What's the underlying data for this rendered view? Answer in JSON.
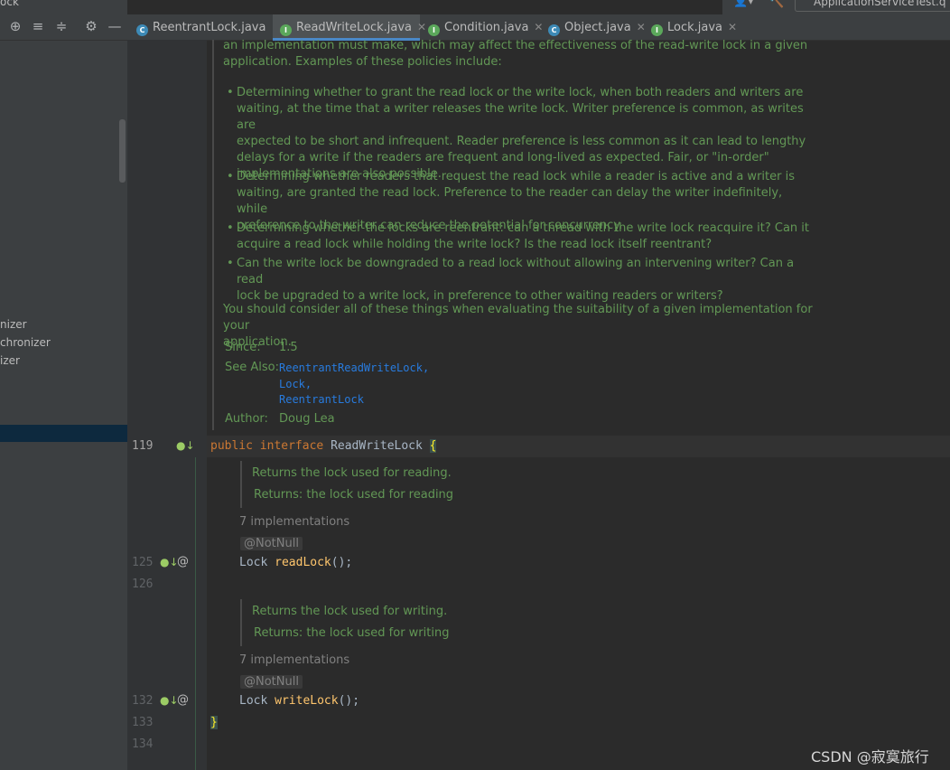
{
  "sidebar": {
    "title_fragment": "ock",
    "items": [
      "nizer",
      "chronizer",
      "izer"
    ]
  },
  "tabs": [
    {
      "label": "ReentrantLock.java",
      "icon": "class-icon",
      "color": "#3d8ab6",
      "active": false
    },
    {
      "label": "ReadWriteLock.java",
      "icon": "interface-icon",
      "color": "#5ba85b",
      "active": true
    },
    {
      "label": "Condition.java",
      "icon": "interface-icon",
      "color": "#5ba85b",
      "active": false
    },
    {
      "label": "Object.java",
      "icon": "class-icon",
      "color": "#3d8ab6",
      "active": false
    },
    {
      "label": "Lock.java",
      "icon": "interface-icon",
      "color": "#5ba85b",
      "active": false
    }
  ],
  "top_right_tab": "ApplicationServiceTest.q",
  "doc": {
    "intro": [
      "an implementation must make, which may affect the effectiveness of the read-write lock in a given",
      "application. Examples of these policies include:"
    ],
    "bullets": [
      [
        "Determining whether to grant the read lock or the write lock, when both readers and writers are",
        "waiting, at the time that a writer releases the write lock. Writer preference is common, as writes are",
        "expected to be short and infrequent. Reader preference is less common as it can lead to lengthy",
        "delays for a write if the readers are frequent and long-lived as expected. Fair, or \"in-order\"",
        "implementations are also possible."
      ],
      [
        "Determining whether readers that request the read lock while a reader is active and a writer is",
        "waiting, are granted the read lock. Preference to the reader can delay the writer indefinitely, while",
        "preference to the writer can reduce the potential for concurrency."
      ],
      [
        "Determining whether the locks are reentrant: can a thread with the write lock reacquire it? Can it",
        "acquire a read lock while holding the write lock? Is the read lock itself reentrant?"
      ],
      [
        "Can the write lock be downgraded to a read lock without allowing an intervening writer? Can a read",
        "lock be upgraded to a write lock, in preference to other waiting readers or writers?"
      ]
    ],
    "closing": [
      "You should consider all of these things when evaluating the suitability of a given implementation for your",
      "application."
    ],
    "since_label": "Since:",
    "since_value": "1.5",
    "see_also_label": "See Also:",
    "see_also": [
      "ReentrantReadWriteLock,",
      "Lock,",
      "ReentrantLock"
    ],
    "author_label": "Author:",
    "author_value": "Doug Lea"
  },
  "code": {
    "line_numbers": [
      "119",
      "125",
      "126",
      "132",
      "133",
      "134"
    ],
    "decl_kw1": "public",
    "decl_kw2": "interface",
    "decl_name": " ReadWriteLock ",
    "decl_brace": "{",
    "read_doc": [
      "Returns the lock used for reading.",
      "Returns: the lock used for reading"
    ],
    "read_impl": "7 implementations",
    "annotation": "@NotNull",
    "read_type": "Lock ",
    "read_fn": "readLock",
    "read_tail": "();",
    "write_doc": [
      "Returns the lock used for writing.",
      "Returns: the lock used for writing"
    ],
    "write_impl": "7 implementations",
    "write_type": "Lock ",
    "write_fn": "writeLock",
    "write_tail": "();",
    "close_brace": "}",
    "gutter_at": "@"
  },
  "watermark": "CSDN @寂寞旅行"
}
